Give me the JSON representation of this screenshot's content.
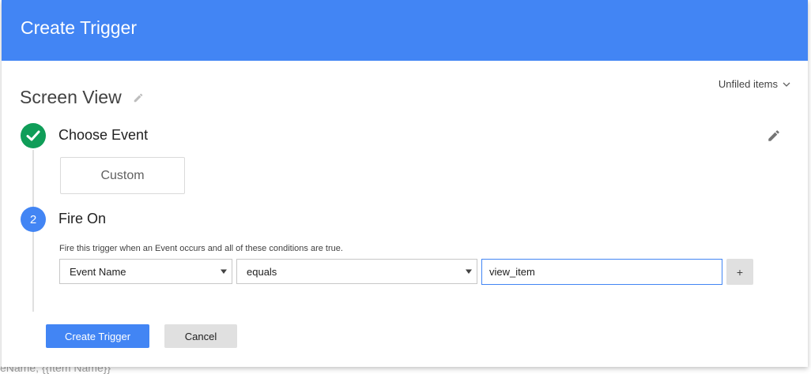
{
  "background_text": "eName, {{Item Name}}",
  "dialog": {
    "title": "Create Trigger",
    "folder": "Unfiled items",
    "trigger_name": "Screen View"
  },
  "steps": [
    {
      "title": "Choose Event",
      "selected_event": "Custom",
      "status": "complete"
    },
    {
      "number": "2",
      "title": "Fire On",
      "description": "Fire this trigger when an Event occurs and all of these conditions are true."
    }
  ],
  "condition": {
    "variable": "Event Name",
    "operator": "equals",
    "value": "view_item",
    "add_label": "+"
  },
  "buttons": {
    "create": "Create Trigger",
    "cancel": "Cancel"
  },
  "colors": {
    "header": "#4285f4",
    "complete": "#0f9d58",
    "active_step": "#4285f4"
  }
}
